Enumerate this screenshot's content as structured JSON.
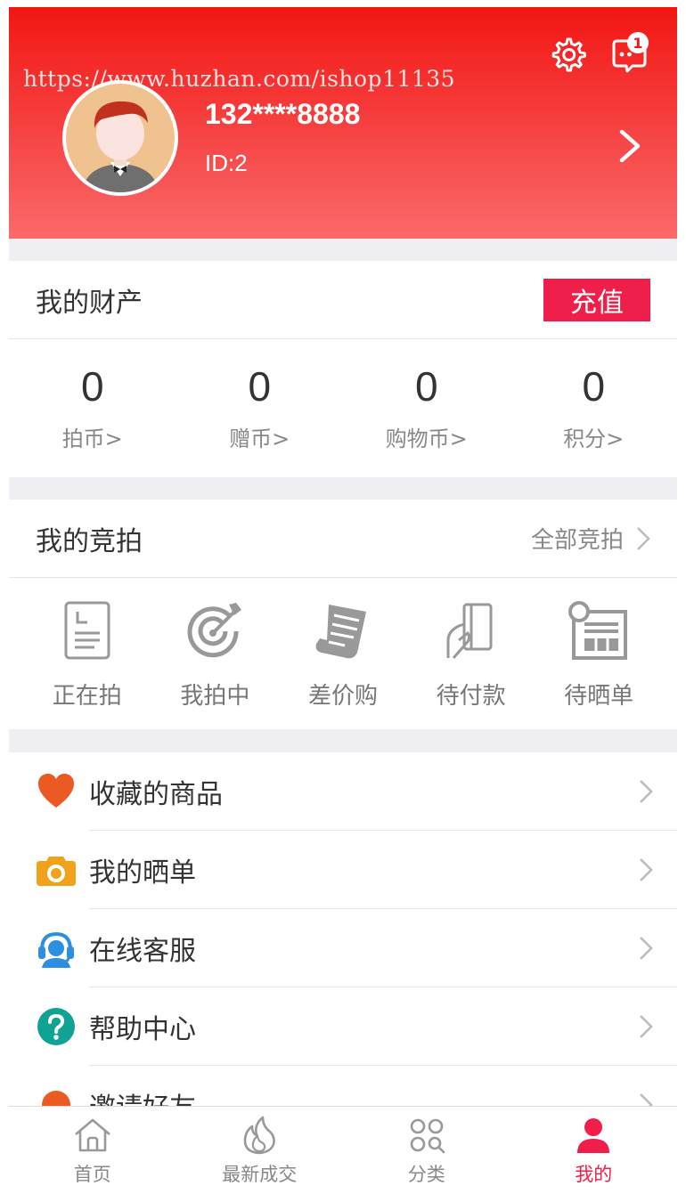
{
  "colors": {
    "primary": "#f21612",
    "accent": "#ef1e4a",
    "heart": "#ea5a22",
    "camera": "#f0a21c",
    "service": "#2d8fe0",
    "help": "#10a294",
    "invite": "#ea5a22"
  },
  "header": {
    "watermark": "https://www.huzhan.com/ishop11135",
    "settings_icon": "gear-icon",
    "message_icon": "message-icon",
    "message_badge": "1",
    "phone": "132****8888",
    "user_id": "ID:2"
  },
  "assets": {
    "title": "我的财产",
    "recharge_label": "充值",
    "items": [
      {
        "value": "0",
        "label": "拍币>"
      },
      {
        "value": "0",
        "label": "赠币>"
      },
      {
        "value": "0",
        "label": "购物币>"
      },
      {
        "value": "0",
        "label": "积分>"
      }
    ]
  },
  "auction": {
    "title": "我的竞拍",
    "all_label": "全部竞拍",
    "items": [
      {
        "label": "正在拍",
        "icon": "document-icon"
      },
      {
        "label": "我拍中",
        "icon": "target-icon"
      },
      {
        "label": "差价购",
        "icon": "receipt-icon"
      },
      {
        "label": "待付款",
        "icon": "card-hand-icon"
      },
      {
        "label": "待晒单",
        "icon": "newspaper-icon"
      }
    ]
  },
  "menu": [
    {
      "label": "收藏的商品",
      "icon": "heart-icon"
    },
    {
      "label": "我的晒单",
      "icon": "camera-icon"
    },
    {
      "label": "在线客服",
      "icon": "customer-service-icon"
    },
    {
      "label": "帮助中心",
      "icon": "help-icon"
    },
    {
      "label": "邀请好友",
      "icon": "invite-icon"
    }
  ],
  "tabbar": [
    {
      "label": "首页",
      "icon": "home-icon"
    },
    {
      "label": "最新成交",
      "icon": "fire-icon"
    },
    {
      "label": "分类",
      "icon": "category-icon"
    },
    {
      "label": "我的",
      "icon": "user-icon",
      "active": true
    }
  ]
}
